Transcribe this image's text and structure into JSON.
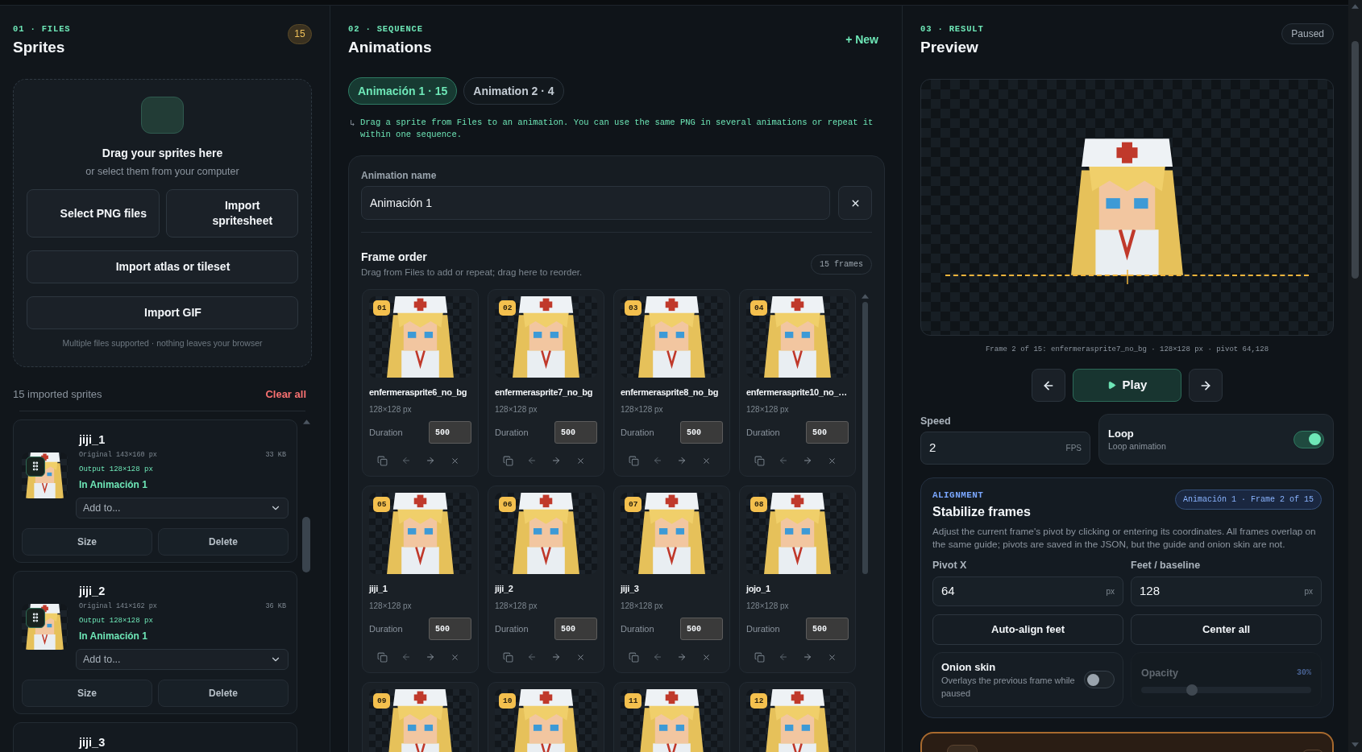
{
  "files": {
    "step": "01 · FILES",
    "title": "Sprites",
    "count": "15",
    "dropzone": {
      "title": "Drag your sprites here",
      "subtitle": "or select them from your computer",
      "button_rows": [
        [
          "Select PNG files",
          "Import spritesheet"
        ],
        [
          "Import atlas or tileset"
        ],
        [
          "Import GIF"
        ]
      ],
      "note": "Multiple files supported · nothing leaves your browser"
    },
    "summary": "15 imported sprites",
    "clear_all": "Clear all",
    "sprites": [
      {
        "name": "jiji_1",
        "original": "Original 143×160 px",
        "file_size": "33 KB",
        "output": "Output 128×128 px",
        "usage": "In Animación 1",
        "add_to": "Add to...",
        "buttons": [
          "Size",
          "Delete"
        ]
      },
      {
        "name": "jiji_2",
        "original": "Original 141×162 px",
        "file_size": "36 KB",
        "output": "Output 128×128 px",
        "usage": "In Animación 1",
        "add_to": "Add to...",
        "buttons": [
          "Size",
          "Delete"
        ]
      },
      {
        "name": "jiji_3"
      }
    ]
  },
  "sequence": {
    "step": "02 · SEQUENCE",
    "title": "Animations",
    "new_label": "+ New",
    "tabs": [
      {
        "label": "Animación 1 · 15",
        "selected": true
      },
      {
        "label": "Animation 2 · 4",
        "selected": false
      }
    ],
    "hint_icon": "↳",
    "hint": "Drag a sprite from Files to an animation. You can use the same PNG in several animations or repeat it within one sequence.",
    "editor": {
      "name_label": "Animation name",
      "name_value": "Animación 1",
      "order_title": "Frame order",
      "order_subtitle": "Drag from Files to add or repeat; drag here to reorder.",
      "frame_count": "15 frames",
      "frames": [
        {
          "number": "01",
          "name": "enfermerasprite6_no_bg",
          "size": "128×128 px",
          "duration_label": "Duration",
          "duration": "500"
        },
        {
          "number": "02",
          "name": "enfermerasprite7_no_bg",
          "size": "128×128 px",
          "duration_label": "Duration",
          "duration": "500"
        },
        {
          "number": "03",
          "name": "enfermerasprite8_no_bg",
          "size": "128×128 px",
          "duration_label": "Duration",
          "duration": "500"
        },
        {
          "number": "04",
          "name": "enfermerasprite10_no_…",
          "size": "128×128 px",
          "duration_label": "Duration",
          "duration": "500"
        },
        {
          "number": "05",
          "name": "jiji_1",
          "size": "128×128 px",
          "duration_label": "Duration",
          "duration": "500"
        },
        {
          "number": "06",
          "name": "jiji_2",
          "size": "128×128 px",
          "duration_label": "Duration",
          "duration": "500"
        },
        {
          "number": "07",
          "name": "jiji_3",
          "size": "128×128 px",
          "duration_label": "Duration",
          "duration": "500"
        },
        {
          "number": "08",
          "name": "jojo_1",
          "size": "128×128 px",
          "duration_label": "Duration",
          "duration": "500"
        },
        {
          "number": "09"
        },
        {
          "number": "10"
        },
        {
          "number": "11"
        },
        {
          "number": "12"
        }
      ]
    }
  },
  "result": {
    "step": "03 · RESULT",
    "title": "Preview",
    "status": "Paused",
    "caption": "Frame 2 of 15: enfermerasprite7_no_bg · 128×128 px · pivot 64,128",
    "play_label": "Play",
    "speed": {
      "label": "Speed",
      "value": "2",
      "unit": "FPS"
    },
    "loop": {
      "title": "Loop",
      "subtitle": "Loop animation",
      "on": true
    },
    "alignment": {
      "eyebrow": "ALIGNMENT",
      "title": "Stabilize frames",
      "context": "Animación 1 · Frame 2 of 15",
      "description": "Adjust the current frame's pivot by clicking or entering its coordinates. All frames overlap on the same guide; pivots are saved in the JSON, but the guide and onion skin are not.",
      "pivot_x": {
        "label": "Pivot X",
        "value": "64",
        "unit": "px"
      },
      "baseline": {
        "label": "Feet / baseline",
        "value": "128",
        "unit": "px"
      },
      "buttons": [
        "Auto-align feet",
        "Center all"
      ],
      "onion": {
        "title": "Onion skin",
        "subtitle": "Overlays the previous frame while paused",
        "on": false
      },
      "opacity": {
        "label": "Opacity",
        "reading": "30%",
        "level": 0.3,
        "disabled": true
      }
    }
  }
}
